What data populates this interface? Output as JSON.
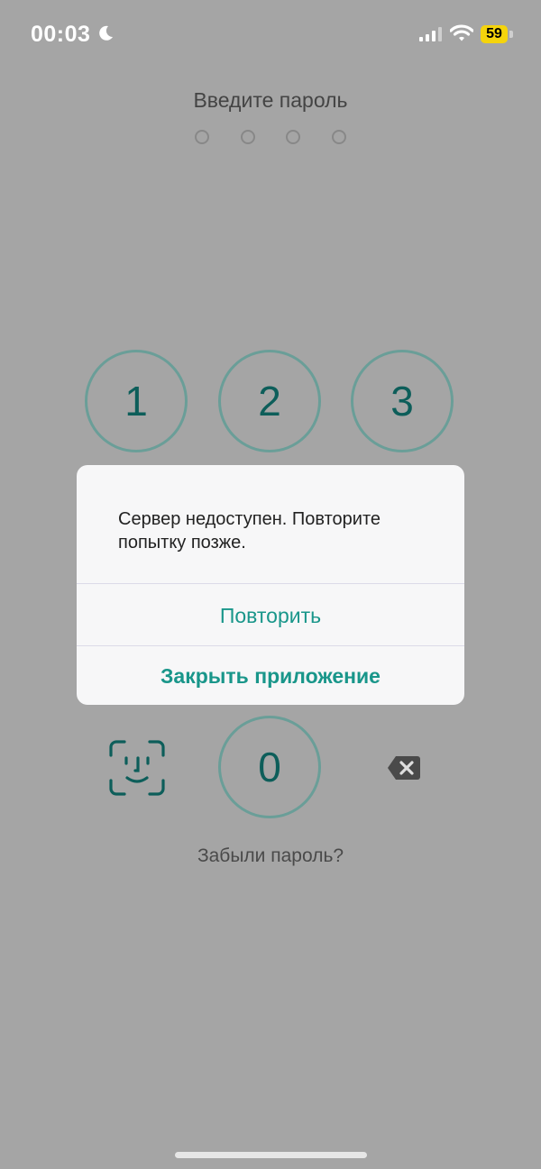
{
  "status": {
    "time": "00:03",
    "battery": "59",
    "icons": [
      "moon-icon",
      "signal-icon",
      "wifi-icon",
      "battery-icon"
    ]
  },
  "screen": {
    "title": "Введите пароль",
    "pin_length": 4,
    "keys": [
      "1",
      "2",
      "3",
      "0"
    ],
    "forgot_link": "Забыли пароль?"
  },
  "dialog": {
    "message": "Сервер недоступен. Повторите попытку позже.",
    "retry_label": "Повторить",
    "close_label": "Закрыть приложение"
  },
  "colors": {
    "accent": "#19968a",
    "key_text": "#0d5e5a",
    "overlay": "#a5a5a5",
    "battery": "#f5d40c"
  }
}
